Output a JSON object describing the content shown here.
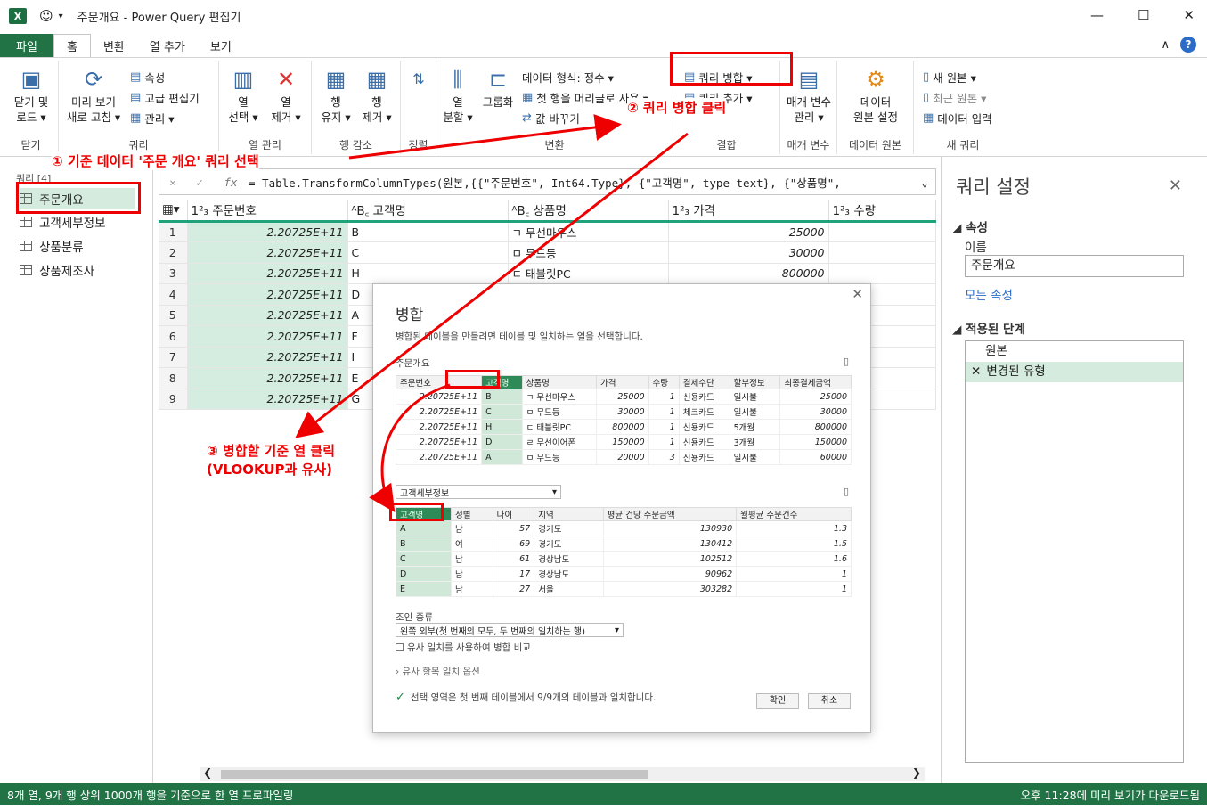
{
  "titlebar": {
    "title": "주문개요 - Power Query 편집기",
    "logo": "X"
  },
  "tabs": [
    {
      "label": "파일"
    },
    {
      "label": "홈"
    },
    {
      "label": "변환"
    },
    {
      "label": "열 추가"
    },
    {
      "label": "보기"
    }
  ],
  "ribbon": {
    "close_load": "닫기 및\n로드 ▾",
    "refresh_preview": "미리 보기\n새로 고침 ▾",
    "properties": "속성",
    "advanced_editor": "고급 편집기",
    "manage": "관리 ▾",
    "choose_cols": "열\n선택 ▾",
    "remove_cols": "열\n제거 ▾",
    "keep_rows": "행\n유지 ▾",
    "remove_rows": "행\n제거 ▾",
    "split_col": "열\n분할 ▾",
    "group_by": "그룹화",
    "data_type": "데이터 형식: 정수 ▾",
    "first_row_header": "첫 행을 머리글로 사용 ▾",
    "replace_values": "값 바꾸기",
    "merge_queries": "쿼리 병합 ▾",
    "append_queries": "쿼리 추가 ▾",
    "manage_params": "매개 변수\n관리 ▾",
    "data_source_settings": "데이터\n원본 설정",
    "new_source": "새 원본 ▾",
    "recent_source": "최근 원본 ▾",
    "enter_data": "데이터 입력",
    "groups": {
      "close": "닫기",
      "query": "쿼리",
      "manage_cols": "열 관리",
      "reduce_rows": "행 감소",
      "sort": "정렬",
      "transform": "변환",
      "combine": "결합",
      "params": "매개 변수",
      "data_source": "데이터 원본",
      "new_query": "새 쿼리"
    }
  },
  "annotations": {
    "a1": "① 기준 데이터 '주문 개요' 쿼리 선택",
    "a2": "② 쿼리 병합 클릭",
    "a3": "③ 병합할 기준 열 클릭\n(VLOOKUP과 유사)"
  },
  "queries": {
    "header": "쿼리 [4]",
    "items": [
      "주문개요",
      "고객세부정보",
      "상품분류",
      "상품제조사"
    ]
  },
  "formula": "= Table.TransformColumnTypes(원본,{{\"주문번호\", Int64.Type}, {\"고객명\", type text}, {\"상품명\",",
  "grid": {
    "columns": [
      "주문번호",
      "고객명",
      "상품명",
      "가격",
      "수량"
    ],
    "rows": [
      [
        "1",
        "2.20725E+11",
        "B",
        "ㄱ 무선마우스",
        "25000"
      ],
      [
        "2",
        "2.20725E+11",
        "C",
        "ㅁ 무드등",
        "30000"
      ],
      [
        "3",
        "2.20725E+11",
        "H",
        "ㄷ 태블릿PC",
        "800000"
      ],
      [
        "4",
        "2.20725E+11",
        "D",
        "",
        ""
      ],
      [
        "5",
        "2.20725E+11",
        "A",
        "",
        ""
      ],
      [
        "6",
        "2.20725E+11",
        "F",
        "",
        ""
      ],
      [
        "7",
        "2.20725E+11",
        "I",
        "",
        ""
      ],
      [
        "8",
        "2.20725E+11",
        "E",
        "",
        ""
      ],
      [
        "9",
        "2.20725E+11",
        "G",
        "",
        ""
      ]
    ]
  },
  "dialog": {
    "title": "병합",
    "desc": "병합된 테이블을 만들려면 테이블 및 일치하는 열을 선택합니다.",
    "table1": "주문개요",
    "t1_cols": [
      "주문번호",
      "고객명",
      "상품명",
      "가격",
      "수량",
      "결제수단",
      "할부정보",
      "최종결제금액"
    ],
    "t1_rows": [
      [
        "2.20725E+11",
        "B",
        "ㄱ 무선마우스",
        "25000",
        "1",
        "신용카드",
        "일시불",
        "25000"
      ],
      [
        "2.20725E+11",
        "C",
        "ㅁ 무드등",
        "30000",
        "1",
        "체크카드",
        "일시불",
        "30000"
      ],
      [
        "2.20725E+11",
        "H",
        "ㄷ 태블릿PC",
        "800000",
        "1",
        "신용카드",
        "5개월",
        "800000"
      ],
      [
        "2.20725E+11",
        "D",
        "ㄹ 무선이어폰",
        "150000",
        "1",
        "신용카드",
        "3개월",
        "150000"
      ],
      [
        "2.20725E+11",
        "A",
        "ㅁ 무드등",
        "20000",
        "3",
        "신용카드",
        "일시불",
        "60000"
      ]
    ],
    "table2": "고객세부정보",
    "t2_cols": [
      "고객명",
      "성별",
      "나이",
      "지역",
      "평균 건당 주문금액",
      "월평균 주문건수"
    ],
    "t2_rows": [
      [
        "A",
        "남",
        "57",
        "경기도",
        "130930",
        "1.3"
      ],
      [
        "B",
        "여",
        "69",
        "경기도",
        "130412",
        "1.5"
      ],
      [
        "C",
        "남",
        "61",
        "경상남도",
        "102512",
        "1.6"
      ],
      [
        "D",
        "남",
        "17",
        "경상남도",
        "90962",
        "1"
      ],
      [
        "E",
        "남",
        "27",
        "서울",
        "303282",
        "1"
      ]
    ],
    "join_label": "조인 종류",
    "join_value": "왼쪽 외부(첫 번째의 모두, 두 번째의 일치하는 행)",
    "fuzzy": "유사 일치를 사용하여 병합 비교",
    "fuzzy_opts": "› 유사 항목 일치 옵션",
    "match_msg": "선택 영역은 첫 번째 테이블에서 9/9개의 테이블과 일치합니다.",
    "ok": "확인",
    "cancel": "취소"
  },
  "settings": {
    "title": "쿼리 설정",
    "props": "◢ 속성",
    "name_lbl": "이름",
    "name_val": "주문개요",
    "all_props": "모든 속성",
    "applied": "◢ 적용된 단계",
    "steps": [
      "원본",
      "변경된 유형"
    ]
  },
  "status": {
    "left": "8개 열, 9개 행    상위 1000개 행을 기준으로 한 열 프로파일링",
    "right": "오후 11:28에 미리 보기가 다운로드됨"
  }
}
